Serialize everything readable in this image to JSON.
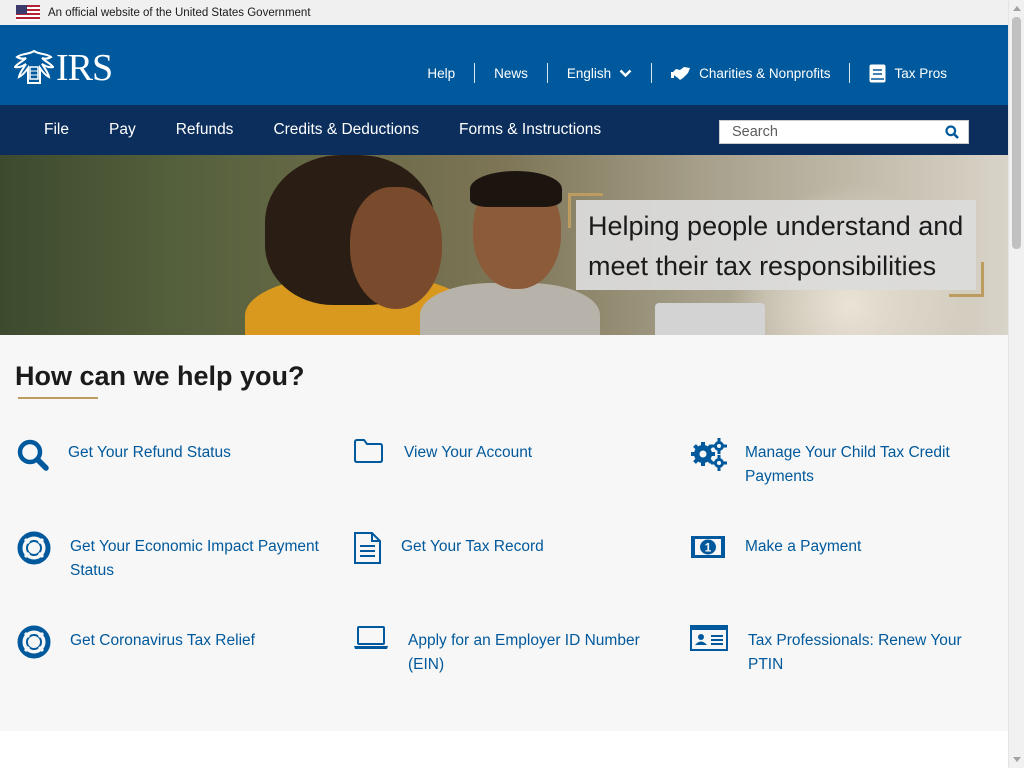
{
  "gov_banner": {
    "text": "An official website of the United States Government"
  },
  "header": {
    "logo_text": "IRS",
    "utility_nav": [
      {
        "label": "Help"
      },
      {
        "label": "News"
      },
      {
        "label": "English",
        "icon": "chevron-down-icon"
      },
      {
        "label": "Charities & Nonprofits",
        "icon": "handshake-icon"
      },
      {
        "label": "Tax Pros",
        "icon": "book-icon"
      }
    ]
  },
  "main_nav": {
    "items": [
      {
        "label": "File"
      },
      {
        "label": "Pay"
      },
      {
        "label": "Refunds"
      },
      {
        "label": "Credits & Deductions"
      },
      {
        "label": "Forms & Instructions"
      }
    ],
    "search": {
      "placeholder": "Search",
      "value": ""
    }
  },
  "hero": {
    "line1": "Helping people understand and",
    "line2": "meet their tax responsibilities"
  },
  "help": {
    "title": "How can we help you?",
    "links": [
      {
        "label": "Get Your Refund Status",
        "icon": "search-icon"
      },
      {
        "label": "View Your Account",
        "icon": "folder-icon"
      },
      {
        "label": "Manage Your Child Tax Credit Payments",
        "icon": "gears-icon"
      },
      {
        "label": "Get Your Economic Impact Payment Status",
        "icon": "life-ring-icon"
      },
      {
        "label": "Get Your Tax Record",
        "icon": "document-icon"
      },
      {
        "label": "Make a Payment",
        "icon": "money-bill-icon"
      },
      {
        "label": "Get Coronavirus Tax Relief",
        "icon": "life-ring-icon"
      },
      {
        "label": "Apply for an Employer ID Number (EIN)",
        "icon": "laptop-icon"
      },
      {
        "label": "Tax Professionals: Renew Your PTIN",
        "icon": "id-card-icon"
      }
    ]
  },
  "colors": {
    "header_blue": "#00599c",
    "nav_navy": "#0b2e5c",
    "link_blue": "#00599c",
    "accent_gold": "#bd9d5f"
  }
}
